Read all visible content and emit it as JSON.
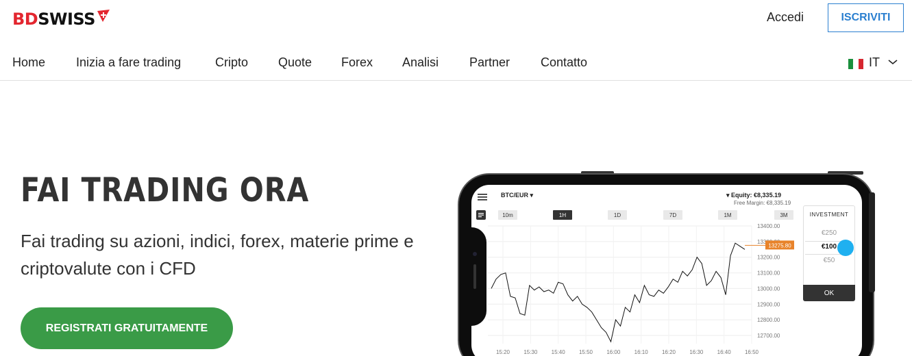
{
  "header": {
    "logo": {
      "part1": "BD",
      "part2": "SWISS"
    },
    "login_label": "Accedi",
    "signup_label": "ISCRIVITI",
    "colors": {
      "brand_red": "#e3262f",
      "link_blue": "#2a7fd0"
    }
  },
  "nav": {
    "items": [
      {
        "label": "Home"
      },
      {
        "label": "Inizia a fare trading"
      },
      {
        "label": "Cripto"
      },
      {
        "label": "Quote"
      },
      {
        "label": "Forex"
      },
      {
        "label": "Analisi"
      },
      {
        "label": "Partner"
      },
      {
        "label": "Contatto"
      }
    ],
    "language": {
      "code": "IT",
      "flag_icon": "italy-flag-icon"
    }
  },
  "hero": {
    "title": "FAI TRADING ORA",
    "subtitle": "Fai trading su azioni, indici, forex, materie prime e criptovalute con i CFD",
    "cta_label": "REGISTRATI GRATUITAMENTE",
    "cta_color": "#3a9b47"
  },
  "app": {
    "symbol": "BTC/EUR",
    "equity": "Equity: €8,335.19",
    "free_margin": "Free Margin: €8,335.19",
    "timeframes": [
      {
        "label": "10m",
        "active": false
      },
      {
        "label": "1H",
        "active": true
      },
      {
        "label": "1D",
        "active": false
      },
      {
        "label": "7D",
        "active": false
      },
      {
        "label": "1M",
        "active": false
      },
      {
        "label": "3M",
        "active": false
      }
    ],
    "investment": {
      "title": "INVESTMENT",
      "options": [
        "€250",
        "€100",
        "€50"
      ],
      "selected": "€100",
      "ok_label": "OK"
    }
  },
  "chart_data": {
    "type": "line",
    "x": [
      "15:20",
      "15:30",
      "15:40",
      "15:50",
      "16:00",
      "16:10",
      "16:20",
      "16:30",
      "16:40",
      "16:50"
    ],
    "y_ticks": [
      13400,
      13300,
      13200,
      13100,
      13000,
      12900,
      12800,
      12700
    ],
    "y_tick_labels": [
      "13400.00",
      "13300.00",
      "13200.00",
      "13100.00",
      "13000.00",
      "12900.00",
      "12800.00",
      "12700.00"
    ],
    "ylim": [
      12700,
      13400
    ],
    "current_price_label": "13275.80",
    "current_price": 13275.8,
    "price_tag_color": "#e8832a",
    "series": [
      {
        "values": [
          13000,
          13060,
          13090,
          13100,
          12950,
          12940,
          12840,
          12830,
          13020,
          12990,
          13010,
          12980,
          12990,
          12970,
          13040,
          13030,
          12960,
          12920,
          12950,
          12900,
          12880,
          12850,
          12800,
          12750,
          12720,
          12660,
          12800,
          12760,
          12880,
          12850,
          12960,
          12910,
          13020,
          12960,
          12950,
          12990,
          12970,
          13010,
          13060,
          13040,
          13110,
          13080,
          13120,
          13200,
          13160,
          13020,
          13050,
          13110,
          13070,
          12960,
          13210,
          13290,
          13270,
          13250
        ]
      }
    ],
    "grid": true
  }
}
